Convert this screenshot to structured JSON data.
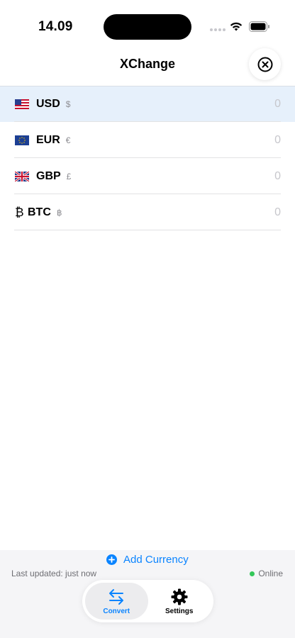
{
  "status_bar": {
    "time": "14.09"
  },
  "header": {
    "title": "XChange",
    "close_icon": "close-circle-icon"
  },
  "currencies": [
    {
      "code": "USD",
      "symbol": "$",
      "amount": "0",
      "flag": "us-flag",
      "selected": true
    },
    {
      "code": "EUR",
      "symbol": "€",
      "amount": "0",
      "flag": "eu-flag",
      "selected": false
    },
    {
      "code": "GBP",
      "symbol": "£",
      "amount": "0",
      "flag": "uk-flag",
      "selected": false
    },
    {
      "code": "BTC",
      "symbol": "฿",
      "amount": "0",
      "glyph": "₿",
      "selected": false
    }
  ],
  "footer": {
    "add_label": "Add Currency",
    "last_updated": "Last updated: just now",
    "status": "Online"
  },
  "tabs": [
    {
      "label": "Convert",
      "icon": "arrows-swap-icon",
      "active": true
    },
    {
      "label": "Settings",
      "icon": "gear-icon",
      "active": false
    }
  ],
  "colors": {
    "accent": "#0a84ff",
    "selected_row": "#e6f0fb",
    "online": "#34c759"
  }
}
